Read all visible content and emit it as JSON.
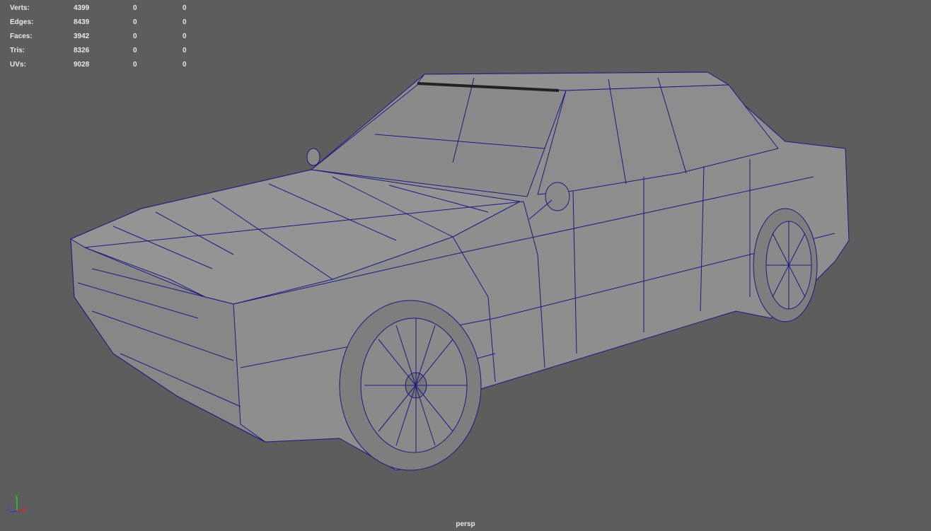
{
  "hud": {
    "rows": [
      {
        "label": "Verts:",
        "v1": "4399",
        "v2": "0",
        "v3": "0"
      },
      {
        "label": "Edges:",
        "v1": "8439",
        "v2": "0",
        "v3": "0"
      },
      {
        "label": "Faces:",
        "v1": "3942",
        "v2": "0",
        "v3": "0"
      },
      {
        "label": "Tris:",
        "v1": "8326",
        "v2": "0",
        "v3": "0"
      },
      {
        "label": "UVs:",
        "v1": "9028",
        "v2": "0",
        "v3": "0"
      }
    ]
  },
  "axis": {
    "x": "x",
    "y": "y",
    "z": "z",
    "x_color": "#e02020",
    "y_color": "#20d020",
    "z_color": "#3030ff"
  },
  "camera_label": "persp",
  "colors": {
    "background": "#5d5d5d",
    "mesh_fill": "#8e8e8e",
    "wire": "#1a1a80"
  }
}
